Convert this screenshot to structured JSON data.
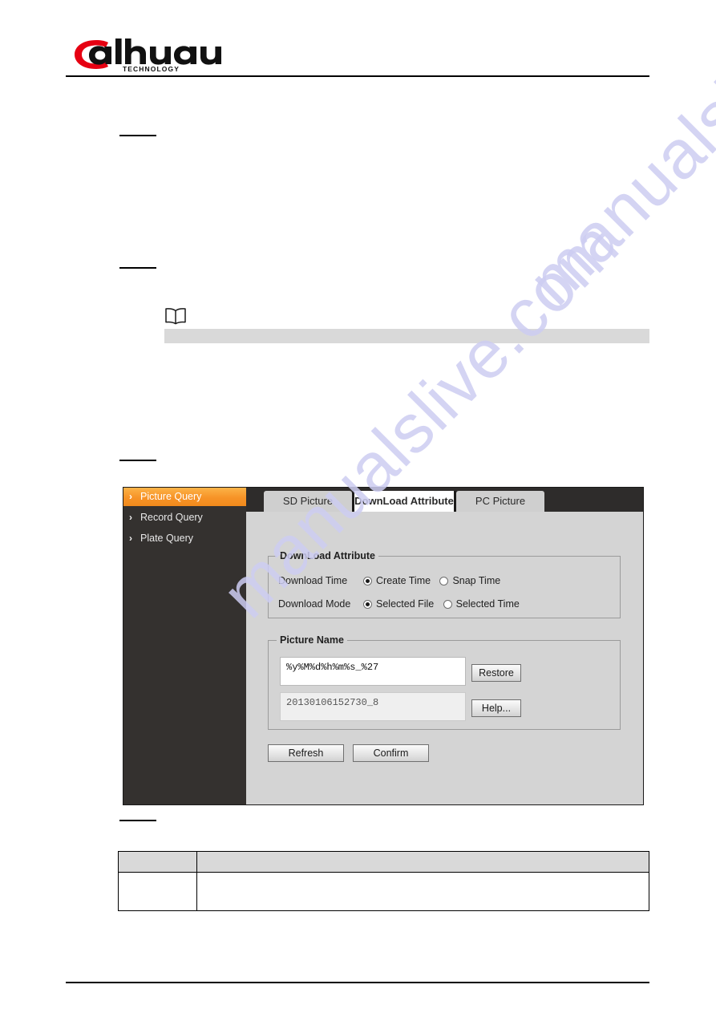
{
  "document": {
    "brand": "alhua",
    "brand_sub": "TECHNOLOGY",
    "watermark": "manualslive.com"
  },
  "ui": {
    "sidebar": {
      "items": [
        {
          "label": "Picture Query",
          "active": true
        },
        {
          "label": "Record Query",
          "active": false
        },
        {
          "label": "Plate Query",
          "active": false
        }
      ],
      "chevron": "›"
    },
    "tabs": [
      {
        "label": "SD Picture",
        "active": false
      },
      {
        "label": "DownLoad Attribute",
        "active": true
      },
      {
        "label": "PC Picture",
        "active": false
      }
    ],
    "download_attribute": {
      "title": "DownLoad Attribute",
      "rows": [
        {
          "label": "Download Time",
          "options": [
            {
              "label": "Create Time",
              "selected": true
            },
            {
              "label": "Snap Time",
              "selected": false
            }
          ]
        },
        {
          "label": "Download Mode",
          "options": [
            {
              "label": "Selected File",
              "selected": true
            },
            {
              "label": "Selected Time",
              "selected": false
            }
          ]
        }
      ]
    },
    "picture_name": {
      "title": "Picture Name",
      "pattern_value": "%y%M%d%h%m%s_%27",
      "preview_value": "20130106152730_8",
      "restore_label": "Restore",
      "help_label": "Help..."
    },
    "actions": {
      "refresh_label": "Refresh",
      "confirm_label": "Confirm"
    }
  },
  "colors": {
    "accent_orange": "#f79327",
    "panel_dark": "#2e2c2b",
    "panel_gray": "#d4d4d4",
    "brand_red": "#e60012",
    "watermark": "#cdcdf2"
  }
}
